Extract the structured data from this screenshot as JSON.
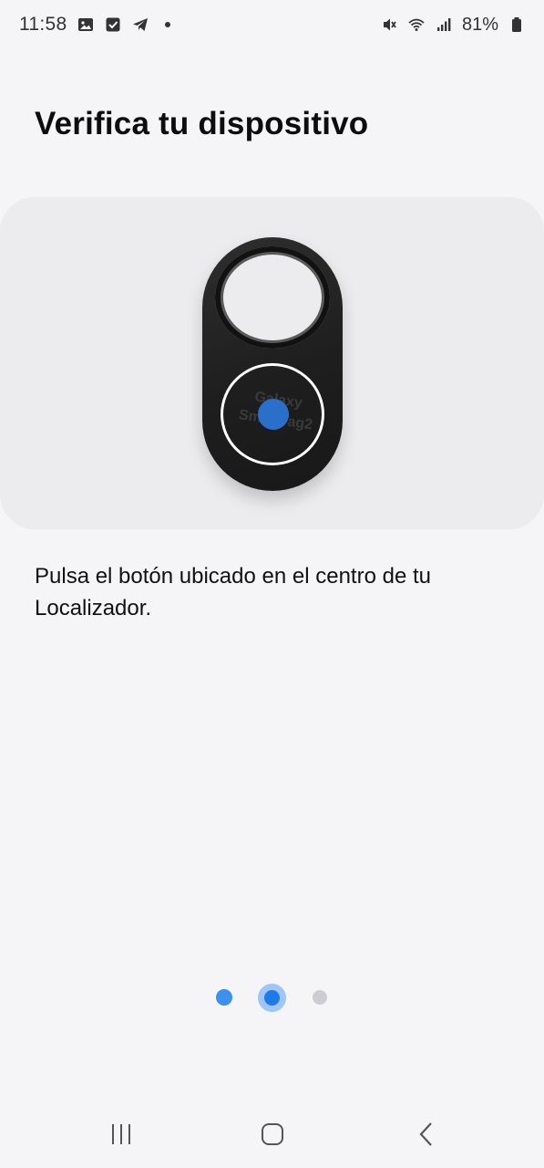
{
  "status_bar": {
    "time": "11:58",
    "battery_percent": "81%",
    "left_icons": [
      "image-icon",
      "checkbox-icon",
      "telegram-icon",
      "dot-icon"
    ],
    "right_icons": [
      "mute-icon",
      "wifi-icon",
      "signal-icon",
      "battery-icon"
    ]
  },
  "page": {
    "title": "Verifica tu dispositivo",
    "instruction": "Pulsa el botón ubicado en el centro de tu Localizador."
  },
  "device_image": {
    "logo_text_line1": "Galaxy",
    "logo_text_line2": "SmartTag2"
  },
  "pager": {
    "total_pages": 3,
    "current_page": 2
  },
  "nav_bar": {
    "buttons": [
      "recent-apps-icon",
      "home-icon",
      "back-icon"
    ]
  },
  "colors": {
    "accent": "#1f7ae8",
    "background": "#f5f5f7",
    "card": "#ececee"
  }
}
